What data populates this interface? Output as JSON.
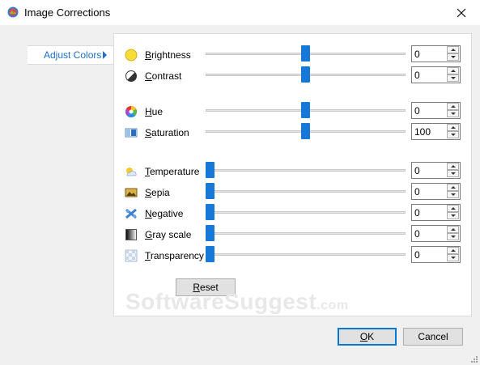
{
  "window": {
    "title": "Image Corrections"
  },
  "sidebar": {
    "items": [
      {
        "label": "Adjust Colors"
      }
    ]
  },
  "sliders": [
    {
      "key": "brightness",
      "label": "Brightness",
      "mnemonic": "B",
      "rest": "rightness",
      "value": "0",
      "position": 0.5,
      "icon": "brightness-icon"
    },
    {
      "key": "contrast",
      "label": "Contrast",
      "mnemonic": "C",
      "rest": "ontrast",
      "value": "0",
      "position": 0.5,
      "icon": "contrast-icon"
    },
    {
      "key": "hue",
      "label": "Hue",
      "mnemonic": "H",
      "rest": "ue",
      "value": "0",
      "position": 0.5,
      "icon": "hue-icon"
    },
    {
      "key": "saturation",
      "label": "Saturation",
      "mnemonic": "S",
      "rest": "aturation",
      "value": "100",
      "position": 0.5,
      "icon": "saturation-icon"
    },
    {
      "key": "temperature",
      "label": "Temperature",
      "mnemonic": "T",
      "rest": "emperature",
      "value": "0",
      "position": 0.0,
      "icon": "temperature-icon"
    },
    {
      "key": "sepia",
      "label": "Sepia",
      "mnemonic": "S",
      "rest": "epia",
      "value": "0",
      "position": 0.0,
      "icon": "sepia-icon"
    },
    {
      "key": "negative",
      "label": "Negative",
      "mnemonic": "N",
      "rest": "egative",
      "value": "0",
      "position": 0.0,
      "icon": "negative-icon"
    },
    {
      "key": "grayscale",
      "label": "Gray scale",
      "mnemonic": "G",
      "rest": "ray scale",
      "value": "0",
      "position": 0.0,
      "icon": "grayscale-icon"
    },
    {
      "key": "transparency",
      "label": "Transparency",
      "mnemonic": "T",
      "rest": "ransparency",
      "value": "0",
      "position": 0.0,
      "icon": "transparency-icon"
    }
  ],
  "buttons": {
    "reset": "Reset",
    "reset_mn": "R",
    "reset_rest": "eset",
    "ok": "OK",
    "ok_mn": "O",
    "ok_rest": "K",
    "cancel": "Cancel"
  },
  "watermark": {
    "main": "SoftwareSuggest",
    "suffix": ".com"
  },
  "colors": {
    "accent": "#1878d7",
    "link": "#1e6fc8"
  }
}
